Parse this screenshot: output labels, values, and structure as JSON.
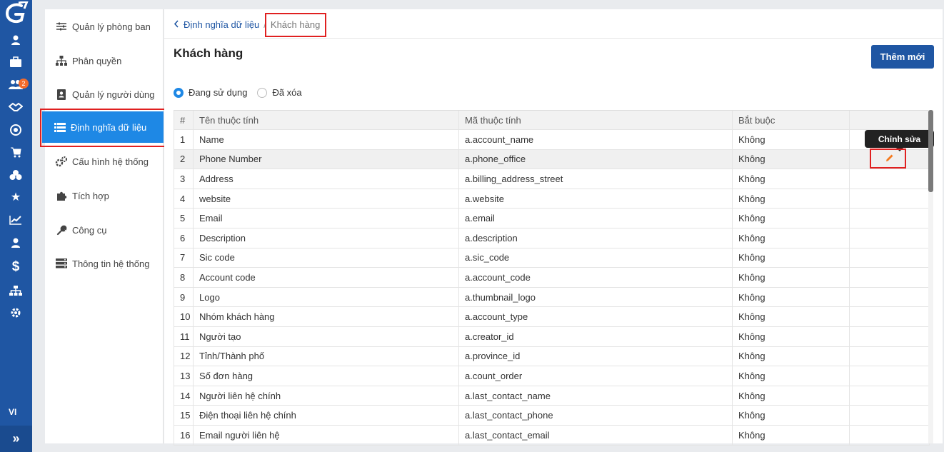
{
  "rail": {
    "badge": "2",
    "lang": "VI",
    "expand": "»"
  },
  "menu": [
    {
      "label": "Quản lý phòng ban",
      "icon": "sliders-icon"
    },
    {
      "label": "Phân quyền",
      "icon": "hierarchy-icon"
    },
    {
      "label": "Quản lý người dùng",
      "icon": "contact-book-icon"
    },
    {
      "label": "Định nghĩa dữ liệu",
      "icon": "list-icon",
      "active": true
    },
    {
      "label": "Cấu hình hệ thống",
      "icon": "gears-icon"
    },
    {
      "label": "Tích hợp",
      "icon": "puzzle-icon"
    },
    {
      "label": "Công cụ",
      "icon": "wrench-icon"
    },
    {
      "label": "Thông tin hệ thống",
      "icon": "server-icon"
    }
  ],
  "breadcrumb": {
    "parent": "Định nghĩa dữ liệu",
    "separator": "/",
    "current": "Khách hàng"
  },
  "page": {
    "title": "Khách hàng",
    "add_button": "Thêm mới"
  },
  "filter": {
    "active_label": "Đang sử dụng",
    "deleted_label": "Đã xóa"
  },
  "table": {
    "headers": [
      "#",
      "Tên thuộc tính",
      "Mã thuộc tính",
      "Bắt buộc",
      ""
    ],
    "rows": [
      [
        "1",
        "Name",
        "a.account_name",
        "Không"
      ],
      [
        "2",
        "Phone Number",
        "a.phone_office",
        "Không"
      ],
      [
        "3",
        "Address",
        "a.billing_address_street",
        "Không"
      ],
      [
        "4",
        "website",
        "a.website",
        "Không"
      ],
      [
        "5",
        "Email",
        "a.email",
        "Không"
      ],
      [
        "6",
        "Description",
        "a.description",
        "Không"
      ],
      [
        "7",
        "Sic code",
        "a.sic_code",
        "Không"
      ],
      [
        "8",
        "Account code",
        "a.account_code",
        "Không"
      ],
      [
        "9",
        "Logo",
        "a.thumbnail_logo",
        "Không"
      ],
      [
        "10",
        "Nhóm khách hàng",
        "a.account_type",
        "Không"
      ],
      [
        "11",
        "Người tạo",
        "a.creator_id",
        "Không"
      ],
      [
        "12",
        "Tỉnh/Thành phố",
        "a.province_id",
        "Không"
      ],
      [
        "13",
        "Số đơn hàng",
        "a.count_order",
        "Không"
      ],
      [
        "14",
        "Người liên hệ chính",
        "a.last_contact_name",
        "Không"
      ],
      [
        "15",
        "Điện thoại liên hệ chính",
        "a.last_contact_phone",
        "Không"
      ],
      [
        "16",
        "Email người liên hệ",
        "a.last_contact_email",
        "Không"
      ]
    ]
  },
  "tooltip": "Chỉnh sửa",
  "colors": {
    "rail": "#1f56a3",
    "active_menu": "#1e88e5",
    "highlight": "#e02020",
    "edit_icon": "#f47b20"
  }
}
